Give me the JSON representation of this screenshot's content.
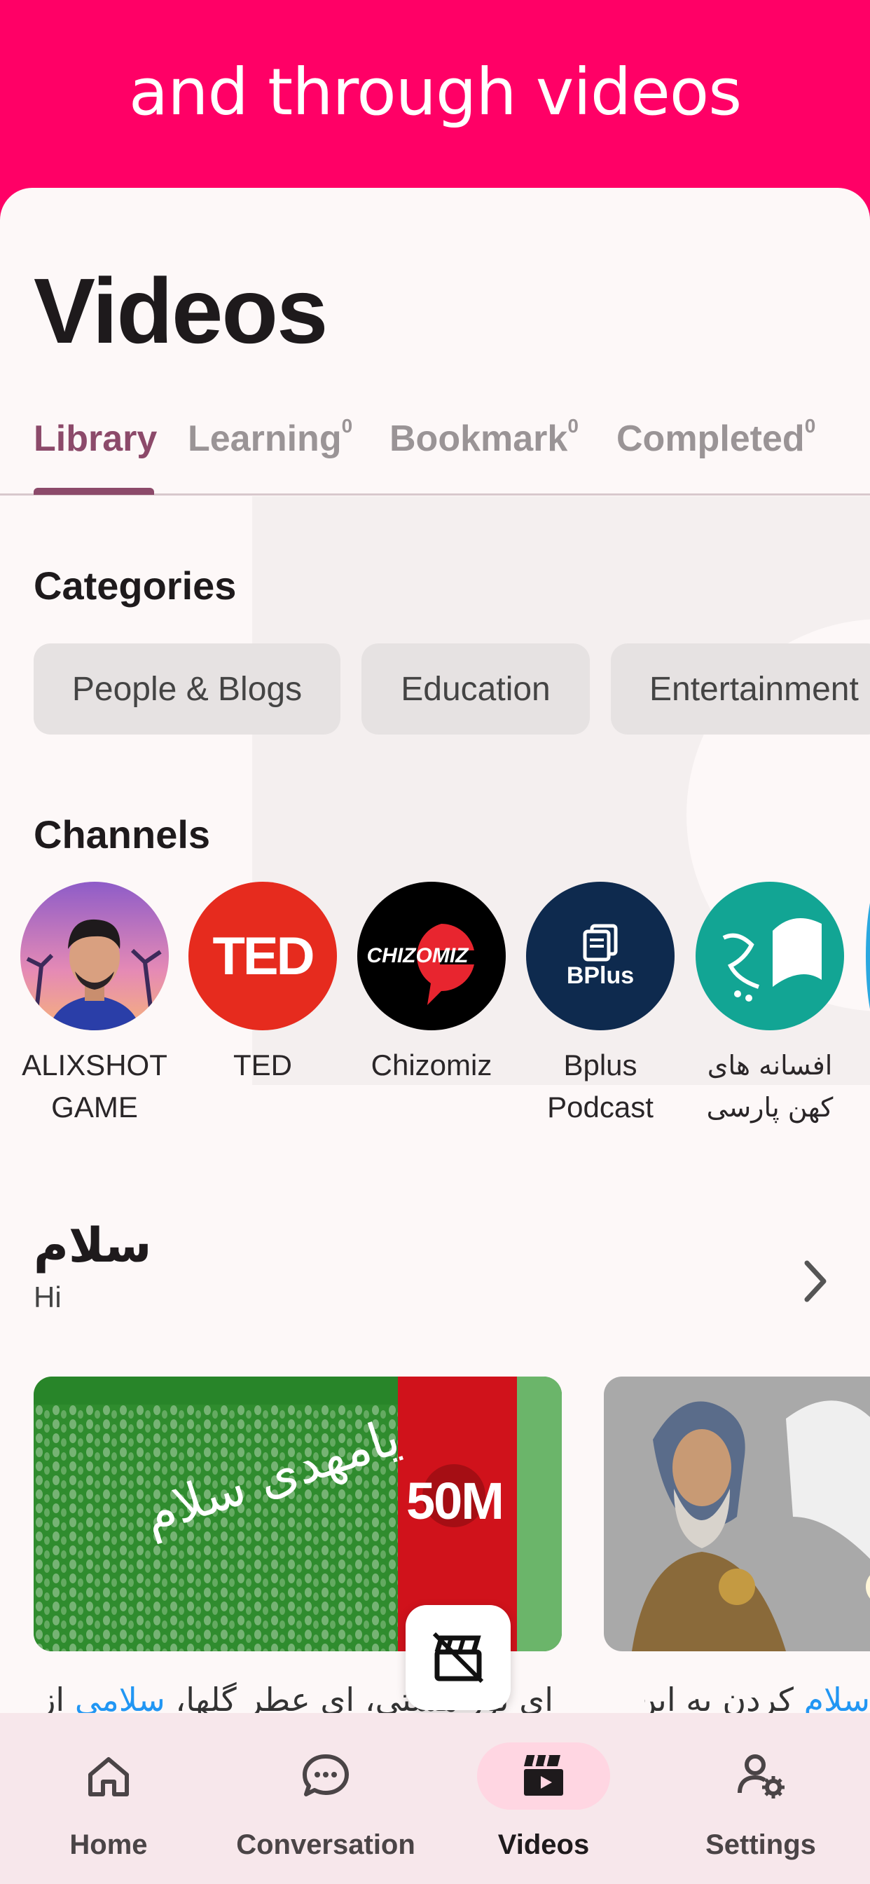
{
  "banner": {
    "text": "and through videos",
    "color": "#FF0066"
  },
  "page": {
    "title": "Videos"
  },
  "tabs": [
    {
      "label": "Library",
      "count": "",
      "active": true
    },
    {
      "label": "Learning",
      "count": "0",
      "active": false
    },
    {
      "label": "Bookmark",
      "count": "0",
      "active": false
    },
    {
      "label": "Completed",
      "count": "0",
      "active": false
    }
  ],
  "categories": {
    "title": "Categories",
    "items": [
      "People & Blogs",
      "Education",
      "Entertainment"
    ]
  },
  "channels": {
    "title": "Channels",
    "items": [
      {
        "name": "ALIXSHOT GAME",
        "avatar": "person-photo-avatar"
      },
      {
        "name": "TED",
        "avatar": "ted-logo",
        "logo_text": "TED",
        "color": "#E62B1E"
      },
      {
        "name": "Chizomiz",
        "avatar": "chizomiz-logo",
        "logo_text": "CHIZOMIZ",
        "color": "#000000"
      },
      {
        "name": "Bplus Podcast",
        "avatar": "bplus-logo",
        "logo_text": "BPlus",
        "color": "#0E2A4E"
      },
      {
        "name": "افسانه های کهن پارسی",
        "avatar": "afsaneh-logo",
        "color": "#12A594"
      }
    ]
  },
  "section": {
    "title": "سلام",
    "subtitle": "Hi"
  },
  "videos": [
    {
      "thumb_text": "یامهدی سلام",
      "badge": "50M",
      "caption_plain": "ای نور هستی، ای عطر گلها، ",
      "caption_highlight": "سلامی",
      "caption_tail": " از"
    },
    {
      "caption_highlight": "سلام",
      "caption_plain": " کردن به این"
    }
  ],
  "bottom_nav": [
    {
      "label": "Home",
      "icon": "home-icon",
      "active": false
    },
    {
      "label": "Conversation",
      "icon": "chat-bubble-icon",
      "active": false
    },
    {
      "label": "Videos",
      "icon": "clapperboard-icon",
      "active": true
    },
    {
      "label": "Settings",
      "icon": "user-settings-icon",
      "active": false
    }
  ]
}
